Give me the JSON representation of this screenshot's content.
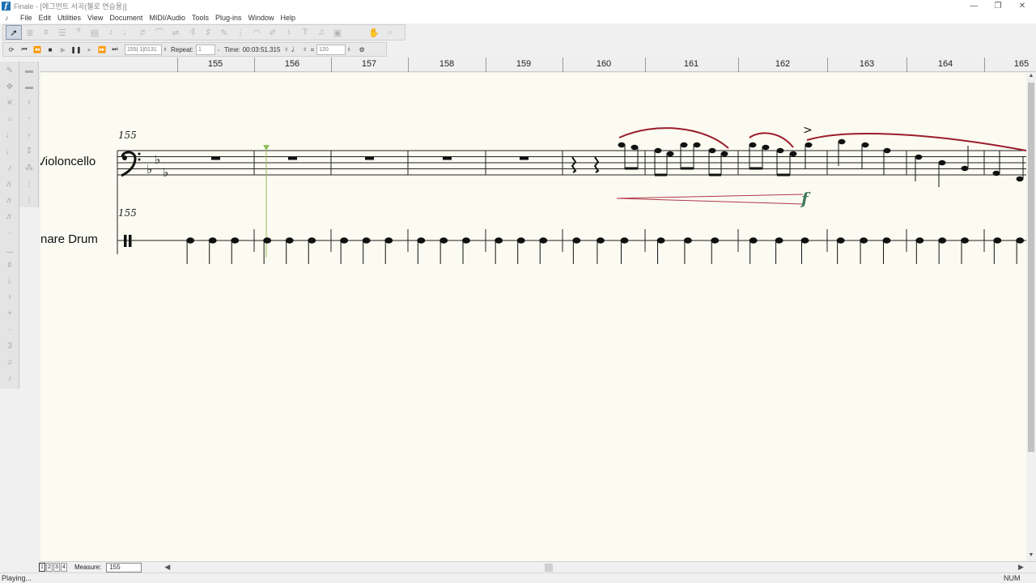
{
  "window": {
    "title": "Finale - [에그먼트 서곡(첼로 연습용)]",
    "app_icon_glyph": "f",
    "min_glyph": "—",
    "restore_glyph": "❐",
    "close_glyph": "✕"
  },
  "menu": [
    "File",
    "Edit",
    "Utilities",
    "View",
    "Document",
    "MIDI/Audio",
    "Tools",
    "Plug-ins",
    "Window",
    "Help"
  ],
  "toolbar_icons": [
    "selection-tool",
    "staff-tool",
    "smart-shape-tool",
    "measure-tool",
    "key-signature-tool",
    "time-signature-tool",
    "clef-tool",
    "simple-entry-tool",
    "speedy-entry-tool",
    "articulation-tool",
    "expression-tool",
    "repeat-tool",
    "chord-tool",
    "lyrics-tool",
    "text-tool",
    "graphics-tool",
    "resize-tool",
    "hand-grabber-tool",
    "zoom-tool"
  ],
  "playback": {
    "counter_value": "155| 1|0131",
    "repeat_label": "Repeat:",
    "repeat_value": "1",
    "time_label": "Time:",
    "time_value": "00:03:51.315",
    "tempo_equals": "=",
    "tempo_value": "120"
  },
  "ruler": {
    "measures": [
      "155",
      "156",
      "157",
      "158",
      "159",
      "160",
      "161",
      "162",
      "163",
      "164",
      "165"
    ]
  },
  "score": {
    "staves": [
      {
        "name": "Violoncello",
        "measure_number": "155"
      },
      {
        "name": "nare Drum",
        "measure_number": "155"
      }
    ],
    "accent": ">",
    "dynamic": "f",
    "slur_color": "#9a1c2c",
    "hairpin_color": "#b0374a",
    "dynamic_color": "#3f7a5a",
    "cursor_color": "#8fbf5a"
  },
  "bottom": {
    "page_tabs": [
      "1",
      "2",
      "3",
      "4"
    ],
    "measure_label": "Measure:",
    "measure_value": "155"
  },
  "status": {
    "left": "Playing...",
    "right": "NUM"
  }
}
